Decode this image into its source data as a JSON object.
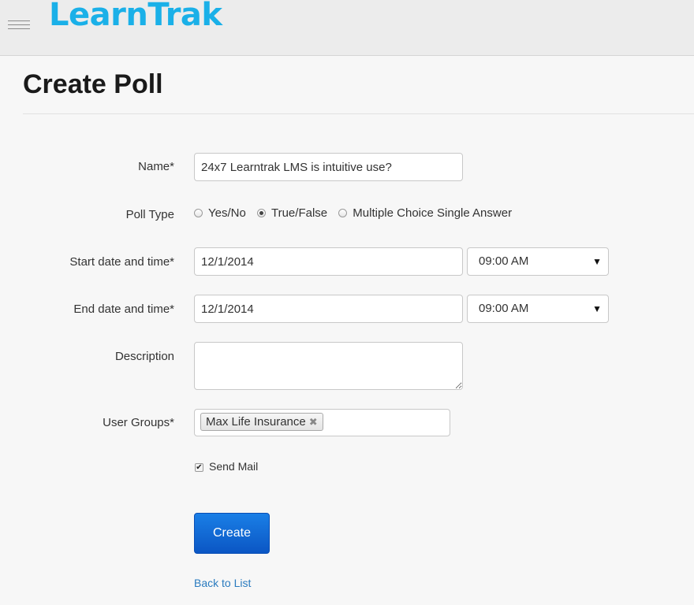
{
  "header": {
    "logo_text": "LearnTrak",
    "menu_icon": "hamburger-menu-icon"
  },
  "page": {
    "title": "Create Poll"
  },
  "form": {
    "name": {
      "label": "Name*",
      "value": "24x7 Learntrak LMS is intuitive use?"
    },
    "poll_type": {
      "label": "Poll Type",
      "options": [
        {
          "label": "Yes/No",
          "selected": false
        },
        {
          "label": "True/False",
          "selected": true
        },
        {
          "label": "Multiple Choice Single Answer",
          "selected": false
        }
      ]
    },
    "start": {
      "label": "Start date and time*",
      "date": "12/1/2014",
      "time": "09:00 AM"
    },
    "end": {
      "label": "End date and time*",
      "date": "12/1/2014",
      "time": "09:00 AM"
    },
    "description": {
      "label": "Description",
      "value": ""
    },
    "user_groups": {
      "label": "User Groups*",
      "tags": [
        "Max Life Insurance"
      ],
      "remove_glyph": "✖"
    },
    "send_mail": {
      "label": "Send Mail",
      "checked": true
    },
    "create_label": "Create",
    "back_label": "Back to List"
  },
  "colors": {
    "logo": "#1ab0e8",
    "button": "#0b56c4",
    "link": "#2a7bbf"
  }
}
